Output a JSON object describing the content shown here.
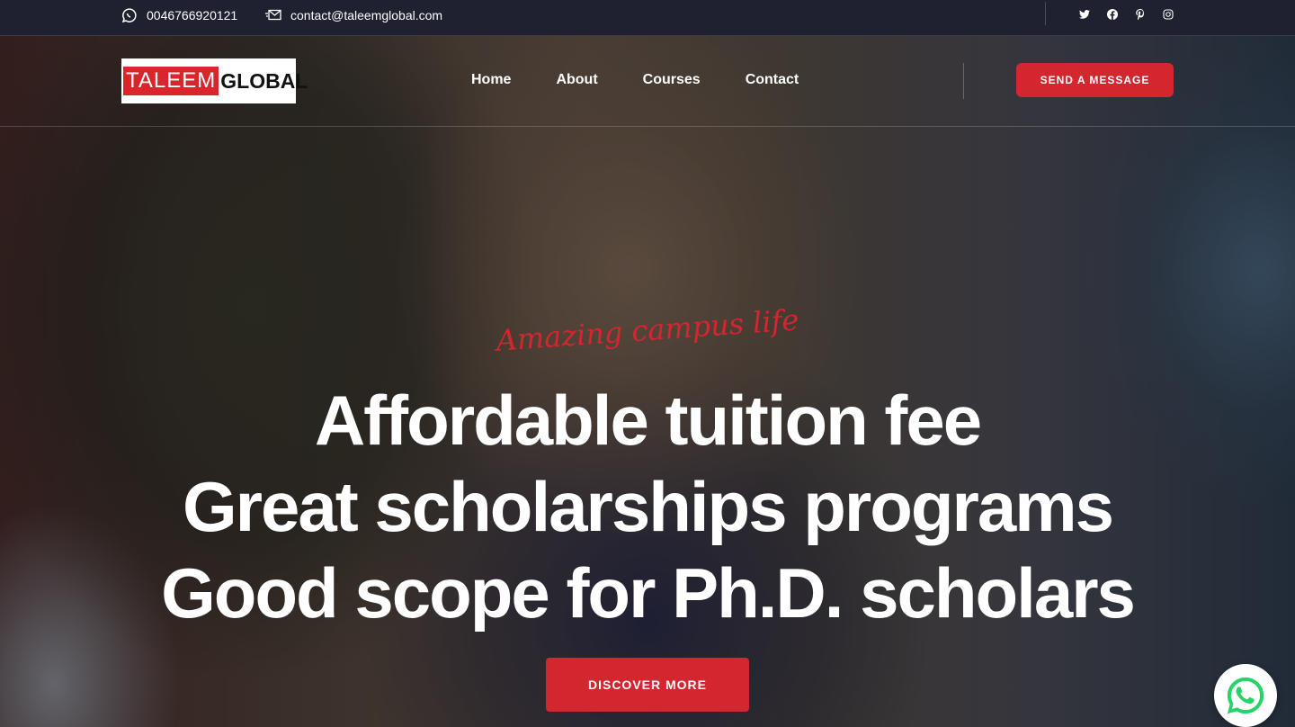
{
  "topbar": {
    "phone": "0046766920121",
    "email": "contact@taleemglobal.com",
    "socials": [
      "twitter-icon",
      "facebook-icon",
      "pinterest-icon",
      "instagram-icon"
    ]
  },
  "logo": {
    "part1": "TALEEM",
    "part2": "GLOBAL"
  },
  "nav": {
    "items": [
      "Home",
      "About",
      "Courses",
      "Contact"
    ]
  },
  "header": {
    "cta_label": "SEND A MESSAGE"
  },
  "hero": {
    "script_text": "Amazing campus life",
    "line1": "Affordable tuition fee",
    "line2": "Great scholarships programs",
    "line3": "Good scope for Ph.D. scholars",
    "cta_label": "DISCOVER MORE"
  },
  "colors": {
    "accent": "#d3262e",
    "topbar": "#1f2030",
    "whatsapp": "#25d366"
  }
}
